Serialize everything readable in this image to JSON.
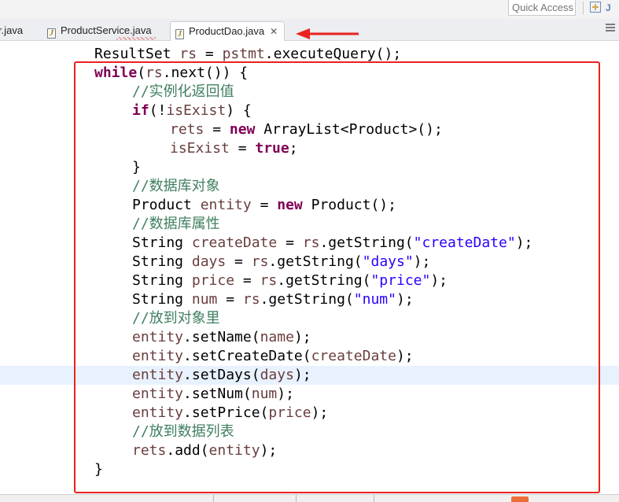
{
  "toolbar": {
    "quick_access_placeholder": "Quick Access"
  },
  "tabs": [
    {
      "label": "r.java",
      "active": false
    },
    {
      "label": "ProductService.java",
      "active": false
    },
    {
      "label": "ProductDao.java",
      "active": true,
      "close": "✕"
    }
  ],
  "colors": {
    "keyword": "#7f0055",
    "variable": "#6a3e3e",
    "string": "#2a00ff",
    "comment": "#3f7f5f",
    "annotation_box": "#e8231f",
    "annotation_arrow": "#e8231f",
    "current_line": "#e8f2fe"
  },
  "code": {
    "lines": [
      {
        "indent": 0,
        "tokens": [
          [
            "t",
            "ResultSet "
          ],
          [
            "v",
            "rs"
          ],
          [
            "t",
            " = "
          ],
          [
            "v",
            "pstmt"
          ],
          [
            "t",
            ".executeQuery();"
          ]
        ]
      },
      {
        "indent": 0,
        "tokens": [
          [
            "k",
            "while"
          ],
          [
            "t",
            "("
          ],
          [
            "v",
            "rs"
          ],
          [
            "t",
            ".next()) {"
          ]
        ]
      },
      {
        "indent": 1,
        "tokens": [
          [
            "c",
            "//实例化返回值"
          ]
        ]
      },
      {
        "indent": 1,
        "tokens": [
          [
            "k",
            "if"
          ],
          [
            "t",
            "(!"
          ],
          [
            "v",
            "isExist"
          ],
          [
            "t",
            ") {"
          ]
        ]
      },
      {
        "indent": 2,
        "tokens": [
          [
            "v",
            "rets"
          ],
          [
            "t",
            " = "
          ],
          [
            "k",
            "new"
          ],
          [
            "t",
            " ArrayList<Product>();"
          ]
        ]
      },
      {
        "indent": 2,
        "tokens": [
          [
            "v",
            "isExist"
          ],
          [
            "t",
            " = "
          ],
          [
            "k",
            "true"
          ],
          [
            "t",
            ";"
          ]
        ]
      },
      {
        "indent": 1,
        "tokens": [
          [
            "t",
            "}"
          ]
        ]
      },
      {
        "indent": 1,
        "tokens": [
          [
            "c",
            "//数据库对象"
          ]
        ]
      },
      {
        "indent": 1,
        "tokens": [
          [
            "t",
            "Product "
          ],
          [
            "v",
            "entity"
          ],
          [
            "t",
            " = "
          ],
          [
            "k",
            "new"
          ],
          [
            "t",
            " Product();"
          ]
        ]
      },
      {
        "indent": 1,
        "tokens": [
          [
            "c",
            "//数据库属性"
          ]
        ]
      },
      {
        "indent": 1,
        "tokens": [
          [
            "t",
            "String "
          ],
          [
            "v",
            "createDate"
          ],
          [
            "t",
            " = "
          ],
          [
            "v",
            "rs"
          ],
          [
            "t",
            ".getString("
          ],
          [
            "s",
            "\"createDate\""
          ],
          [
            "t",
            ");"
          ]
        ]
      },
      {
        "indent": 1,
        "tokens": [
          [
            "t",
            "String "
          ],
          [
            "v",
            "days"
          ],
          [
            "t",
            " = "
          ],
          [
            "v",
            "rs"
          ],
          [
            "t",
            ".getString("
          ],
          [
            "s",
            "\"days\""
          ],
          [
            "t",
            ");"
          ]
        ]
      },
      {
        "indent": 1,
        "tokens": [
          [
            "t",
            "String "
          ],
          [
            "v",
            "price"
          ],
          [
            "t",
            " = "
          ],
          [
            "v",
            "rs"
          ],
          [
            "t",
            ".getString("
          ],
          [
            "s",
            "\"price\""
          ],
          [
            "t",
            ");"
          ]
        ]
      },
      {
        "indent": 1,
        "tokens": [
          [
            "t",
            "String "
          ],
          [
            "v",
            "num"
          ],
          [
            "t",
            " = "
          ],
          [
            "v",
            "rs"
          ],
          [
            "t",
            ".getString("
          ],
          [
            "s",
            "\"num\""
          ],
          [
            "t",
            ");"
          ]
        ]
      },
      {
        "indent": 1,
        "tokens": [
          [
            "c",
            "//放到对象里"
          ]
        ]
      },
      {
        "indent": 1,
        "tokens": [
          [
            "v",
            "entity"
          ],
          [
            "t",
            ".setName("
          ],
          [
            "v",
            "name"
          ],
          [
            "t",
            ");"
          ]
        ]
      },
      {
        "indent": 1,
        "tokens": [
          [
            "v",
            "entity"
          ],
          [
            "t",
            ".setCreateDate("
          ],
          [
            "v",
            "createDate"
          ],
          [
            "t",
            ");"
          ]
        ]
      },
      {
        "indent": 1,
        "current": true,
        "tokens": [
          [
            "v",
            "entity"
          ],
          [
            "t",
            ".setDays("
          ],
          [
            "v",
            "days"
          ],
          [
            "t",
            ");"
          ]
        ]
      },
      {
        "indent": 1,
        "tokens": [
          [
            "v",
            "entity"
          ],
          [
            "t",
            ".setNum("
          ],
          [
            "v",
            "num"
          ],
          [
            "t",
            ");"
          ]
        ]
      },
      {
        "indent": 1,
        "tokens": [
          [
            "v",
            "entity"
          ],
          [
            "t",
            ".setPrice("
          ],
          [
            "v",
            "price"
          ],
          [
            "t",
            ");"
          ]
        ]
      },
      {
        "indent": 1,
        "tokens": [
          [
            "c",
            "//放到数据列表"
          ]
        ]
      },
      {
        "indent": 1,
        "tokens": [
          [
            "v",
            "rets"
          ],
          [
            "t",
            ".add("
          ],
          [
            "v",
            "entity"
          ],
          [
            "t",
            ");"
          ]
        ]
      },
      {
        "indent": 0,
        "tokens": [
          [
            "t",
            "}"
          ]
        ]
      }
    ]
  }
}
